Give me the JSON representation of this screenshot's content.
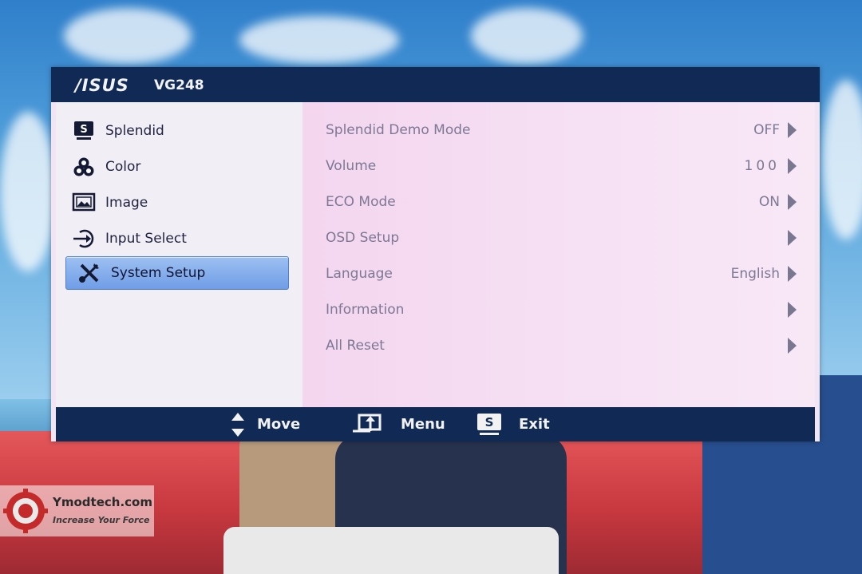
{
  "header": {
    "brand": "/ISUS",
    "model": "VG248"
  },
  "sidebar": {
    "items": [
      {
        "label": "Splendid",
        "icon": "splendid-s-icon",
        "selected": false
      },
      {
        "label": "Color",
        "icon": "rgb-circles-icon",
        "selected": false
      },
      {
        "label": "Image",
        "icon": "image-icon",
        "selected": false
      },
      {
        "label": "Input Select",
        "icon": "input-select-icon",
        "selected": false
      },
      {
        "label": "System Setup",
        "icon": "wrench-screwdriver-icon",
        "selected": true
      }
    ]
  },
  "settings": {
    "rows": [
      {
        "label": "Splendid Demo Mode",
        "value": "OFF"
      },
      {
        "label": "Volume",
        "value": "100"
      },
      {
        "label": "ECO Mode",
        "value": "ON"
      },
      {
        "label": "OSD Setup",
        "value": ""
      },
      {
        "label": "Language",
        "value": "English"
      },
      {
        "label": "Information",
        "value": ""
      },
      {
        "label": "All Reset",
        "value": ""
      }
    ]
  },
  "footer": {
    "move": "Move",
    "menu": "Menu",
    "exit": "Exit"
  },
  "watermark": {
    "title": "Ymodtech.com",
    "tagline": "Increase Your Force"
  },
  "colors": {
    "header_bar": "#102a55",
    "selected_item": "#7fa8ec",
    "option_text": "#7d7894"
  }
}
